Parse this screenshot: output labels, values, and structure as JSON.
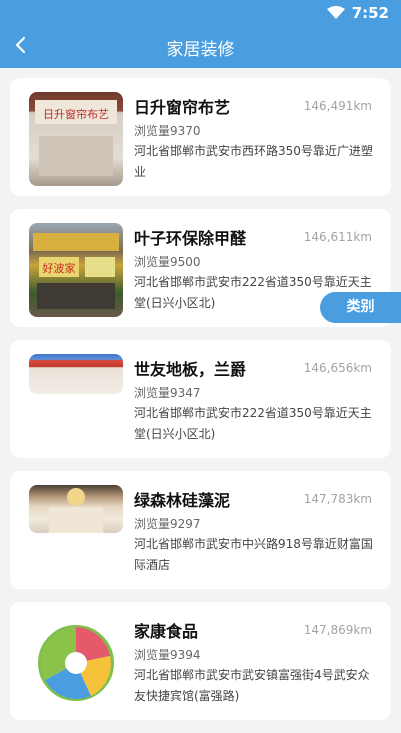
{
  "status_bar": {
    "time": "7:52"
  },
  "header": {
    "title": "家居装修"
  },
  "category_button": {
    "label": "类别"
  },
  "items": [
    {
      "name": "日升窗帘布艺",
      "distance": "146,491km",
      "views": "浏览量9370",
      "address": "河北省邯郸市武安市西环路350号靠近广进塑业",
      "thumb_text": "日升窗帘布艺"
    },
    {
      "name": "叶子环保除甲醛",
      "distance": "146,611km",
      "views": "浏览量9500",
      "address": "河北省邯郸市武安市222省道350号靠近天主堂(日兴小区北)",
      "thumb_text": "好波家"
    },
    {
      "name": "世友地板，兰爵",
      "distance": "146,656km",
      "views": "浏览量9347",
      "address": "河北省邯郸市武安市222省道350号靠近天主堂(日兴小区北)"
    },
    {
      "name": "绿森林硅藻泥",
      "distance": "147,783km",
      "views": "浏览量9297",
      "address": "河北省邯郸市武安市中兴路918号靠近财富国际酒店"
    },
    {
      "name": "家康食品",
      "distance": "147,869km",
      "views": "浏览量9394",
      "address": "河北省邯郸市武安市武安镇富强街4号武安众友快捷宾馆(富强路)"
    }
  ]
}
